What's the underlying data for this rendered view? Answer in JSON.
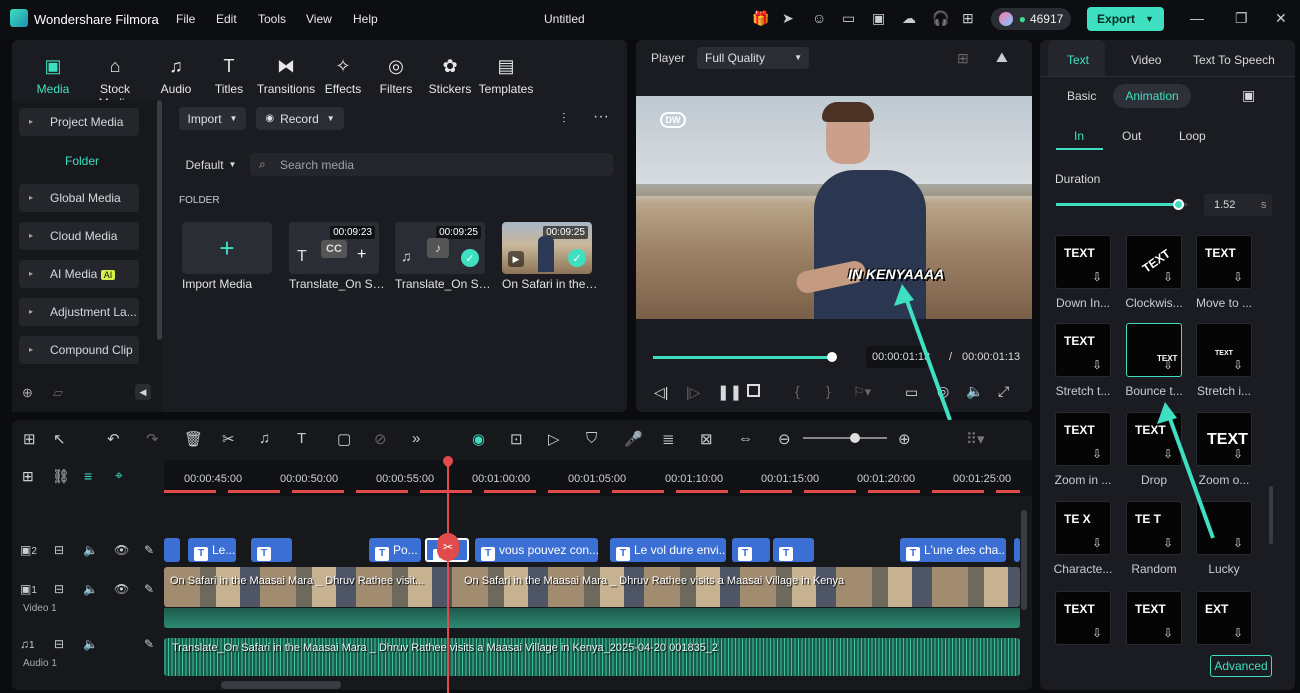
{
  "app": {
    "name": "Wondershare Filmora",
    "title": "Untitled",
    "credits": "46917",
    "export_label": "Export"
  },
  "menu": [
    "File",
    "Edit",
    "Tools",
    "View",
    "Help"
  ],
  "media_tabs": [
    {
      "label": "Media",
      "icon": "media-icon"
    },
    {
      "label": "Stock Media",
      "icon": "stock-icon"
    },
    {
      "label": "Audio",
      "icon": "audio-icon"
    },
    {
      "label": "Titles",
      "icon": "titles-icon"
    },
    {
      "label": "Transitions",
      "icon": "transitions-icon"
    },
    {
      "label": "Effects",
      "icon": "effects-icon"
    },
    {
      "label": "Filters",
      "icon": "filters-icon"
    },
    {
      "label": "Stickers",
      "icon": "stickers-icon"
    },
    {
      "label": "Templates",
      "icon": "templates-icon"
    }
  ],
  "sidebar": {
    "project_media": "Project Media",
    "folder": "Folder",
    "items": [
      "Global Media",
      "Cloud Media",
      "AI Media",
      "Adjustment La...",
      "Compound Clip"
    ],
    "ai_badge": "AI"
  },
  "media": {
    "import_label": "Import",
    "record_label": "Record",
    "sort_label": "Default",
    "search_placeholder": "Search media",
    "folder_heading": "FOLDER",
    "import_media": "Import Media",
    "items": [
      {
        "name": "Translate_On Saf...",
        "duration": "00:09:23"
      },
      {
        "name": "Translate_On Saf...",
        "duration": "00:09:25"
      },
      {
        "name": "On Safari in the ...",
        "duration": "00:09:25"
      }
    ]
  },
  "player": {
    "label": "Player",
    "quality": "Full Quality",
    "caption": "IN KENYAAAA",
    "watermark": "DW",
    "current": "00:00:01:13",
    "separator": "/",
    "total": "00:00:01:13",
    "progress": 0.98
  },
  "right_panel": {
    "tabs": [
      "Text",
      "Video",
      "Text To Speech"
    ],
    "subtabs": [
      "Basic",
      "Animation"
    ],
    "anim_tabs": [
      "In",
      "Out",
      "Loop"
    ],
    "duration_label": "Duration",
    "duration_value": "1.52",
    "duration_unit": "s",
    "duration_fraction": 0.93,
    "presets": [
      {
        "label": "Down In...",
        "glyph": "TEXT"
      },
      {
        "label": "Clockwis...",
        "glyph": "TEXT"
      },
      {
        "label": "Move to ...",
        "glyph": "TEXT"
      },
      {
        "label": "Stretch t...",
        "glyph": "TEXT"
      },
      {
        "label": "Bounce t...",
        "glyph": "TEXT"
      },
      {
        "label": "Stretch i...",
        "glyph": "TEXT"
      },
      {
        "label": "Zoom in ...",
        "glyph": "TEXT"
      },
      {
        "label": "Drop",
        "glyph": "TEXT"
      },
      {
        "label": "Zoom o...",
        "glyph": "TEXT"
      },
      {
        "label": "Characte...",
        "glyph": "TE X"
      },
      {
        "label": "Random",
        "glyph": "TE T"
      },
      {
        "label": "Lucky",
        "glyph": ""
      },
      {
        "label": "",
        "glyph": "TEXT"
      },
      {
        "label": "",
        "glyph": "TEXT"
      },
      {
        "label": "",
        "glyph": "EXT"
      }
    ],
    "advanced_label": "Advanced"
  },
  "timeline": {
    "ruler": [
      "00:00:45:00",
      "00:00:50:00",
      "00:00:55:00",
      "00:01:00:00",
      "00:01:05:00",
      "00:01:10:00",
      "00:01:15:00",
      "00:01:20:00",
      "00:01:25:00"
    ],
    "text_clips": [
      "Le...",
      "",
      "Po...",
      "",
      "vous pouvez con...",
      "Le vol dure envi...",
      "",
      "",
      "L'une des cha..."
    ],
    "video_clip": "On Safari in the Maasai Mara _ Dhruv Rathee visit...",
    "video_clip2": "On Safari in the Maasai Mara _ Dhruv Rathee visits a Maasai Village in Kenya",
    "audio_clip": "Translate_On Safari in the Maasai Mara _ Dhruv Rathee visits a Maasai Village in Kenya_2025-04-20 001835_2",
    "tracks": [
      {
        "num": "2",
        "label": ""
      },
      {
        "num": "1",
        "label": "Video 1"
      },
      {
        "num": "1",
        "label": "Audio 1"
      }
    ]
  }
}
